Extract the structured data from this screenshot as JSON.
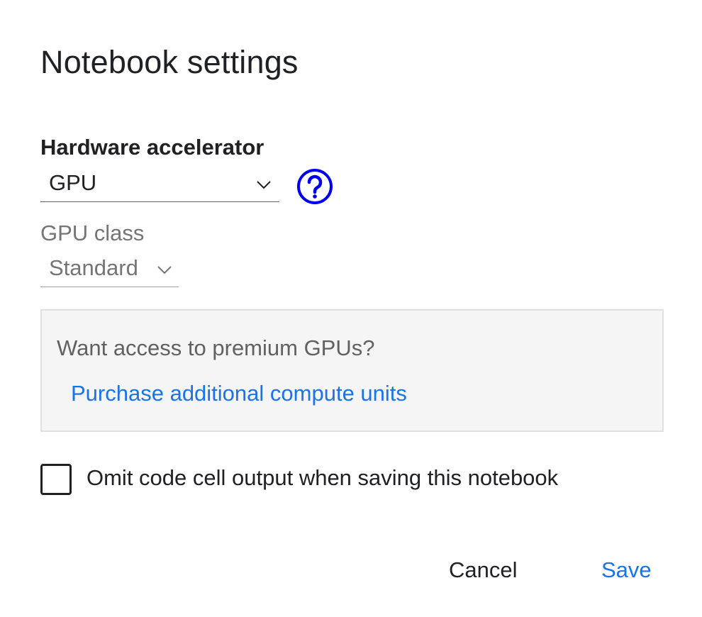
{
  "dialog": {
    "title": "Notebook settings"
  },
  "hardware_accelerator": {
    "label": "Hardware accelerator",
    "selected": "GPU",
    "icon": "help-circle-icon",
    "icon_color": "#0000ee"
  },
  "gpu_class": {
    "label": "GPU class",
    "selected": "Standard"
  },
  "premium_promo": {
    "text": "Want access to premium GPUs?",
    "link_label": "Purchase additional compute units"
  },
  "omit_output": {
    "label": "Omit code cell output when saving this notebook",
    "checked": false
  },
  "actions": {
    "cancel_label": "Cancel",
    "save_label": "Save"
  },
  "colors": {
    "accent": "#1a73e8",
    "text_primary": "#202124",
    "text_muted": "#757575",
    "panel_bg": "#f5f5f5"
  }
}
